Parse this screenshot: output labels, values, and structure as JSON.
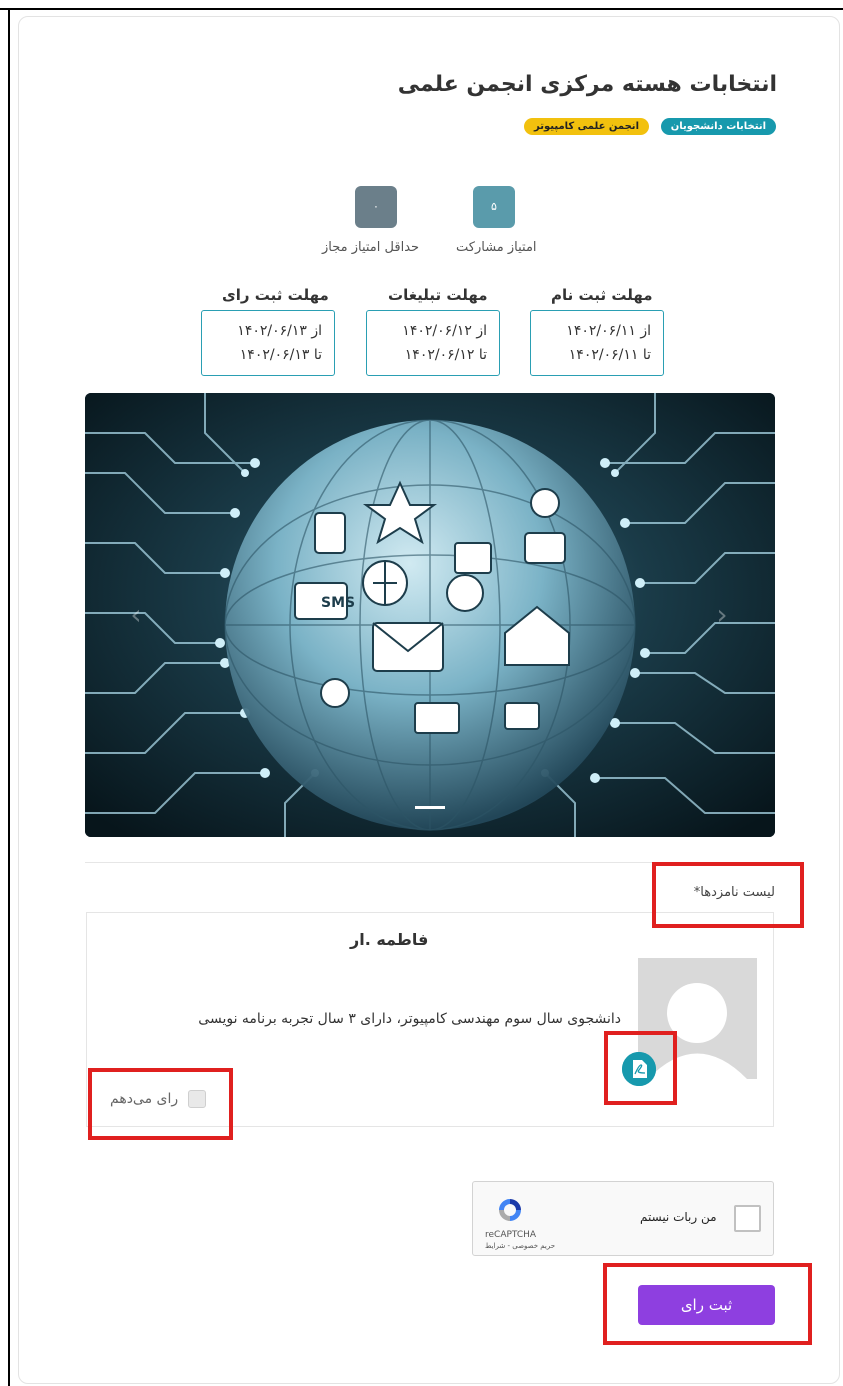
{
  "election": {
    "title": "انتخابات هسته مرکزی انجمن علمی",
    "tags": [
      "انتخابات دانشجویان",
      "انجمن علمی کامپیوتر"
    ]
  },
  "scores": {
    "participation": {
      "value": "۵",
      "label": "امتیاز مشارکت"
    },
    "min_allowed": {
      "value": "۰",
      "label": "حداقل امتیاز مجاز"
    }
  },
  "deadlines": [
    {
      "title": "مهلت ثبت نام",
      "from": "از ۱۴۰۲/۰۶/۱۱",
      "to": "تا ۱۴۰۲/۰۶/۱۱"
    },
    {
      "title": "مهلت تبلیغات",
      "from": "از ۱۴۰۲/۰۶/۱۲",
      "to": "تا ۱۴۰۲/۰۶/۱۲"
    },
    {
      "title": "مهلت ثبت رای",
      "from": "از ۱۴۰۲/۰۶/۱۳",
      "to": "تا ۱۴۰۲/۰۶/۱۳"
    }
  ],
  "carousel": {
    "prev_icon": "chevron-left-icon",
    "next_icon": "chevron-right-icon",
    "sms_text": "SMS"
  },
  "candidates": {
    "list_label": "لیست نامزدها*",
    "items": [
      {
        "name": "فاطمه       .ار",
        "description": "دانشجوی سال سوم مهندسی کامپیوتر، دارای ۳ سال تجربه برنامه نویسی",
        "resume_icon": "pdf-icon",
        "vote_label": "رای می‌دهم",
        "vote_checked": false
      }
    ]
  },
  "captcha": {
    "label": "من ربات نیستم",
    "brand": "reCAPTCHA",
    "links": "حریم خصوصی - شرایط"
  },
  "submit": {
    "label": "ثبت رای"
  },
  "colors": {
    "teal": "#1799ad",
    "yellow": "#f2c10e",
    "purple": "#8e3fe0",
    "highlight": "#e0201f"
  }
}
